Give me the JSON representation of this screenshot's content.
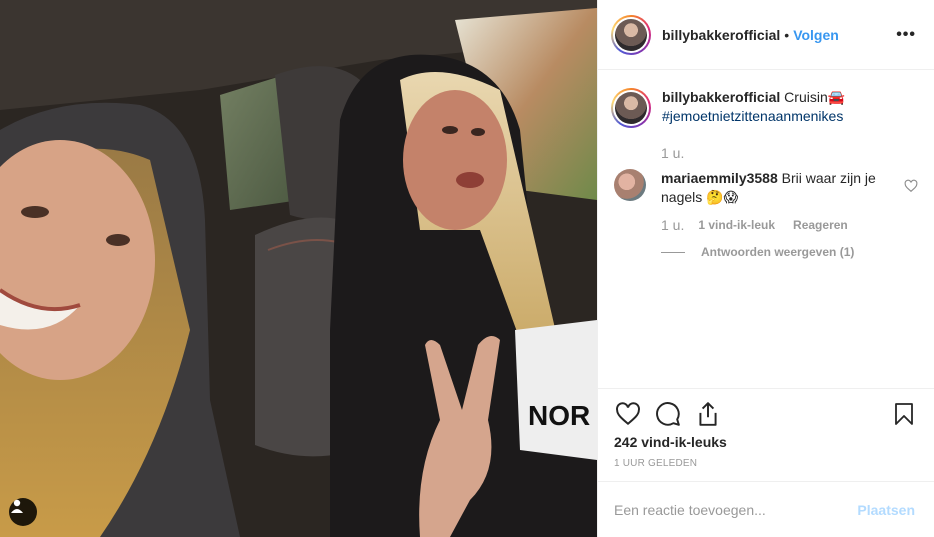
{
  "post": {
    "username": "billybakkerofficial",
    "follow_separator": "•",
    "follow_label": "Volgen",
    "more_icon": "more-options-icon",
    "more_label": "•••"
  },
  "caption": {
    "username": "billybakkerofficial",
    "text": "Cruisin🚘",
    "hashtag": "#jemoetnietzittenaanmenikes",
    "time": "1 u."
  },
  "comment": {
    "username": "mariaemmily3588",
    "text": "Brii waar zijn je nagels 🤔😱",
    "time": "1 u.",
    "likes_label": "1 vind-ik-leuk",
    "reply_label": "Reageren",
    "view_replies_label": "Antwoorden weergeven (1)"
  },
  "actions": {
    "like_icon": "heart-icon",
    "comment_icon": "comment-icon",
    "share_icon": "share-icon",
    "save_icon": "bookmark-icon"
  },
  "likes": "242 vind-ik-leuks",
  "timestamp": "1 UUR GELEDEN",
  "add_comment": {
    "placeholder": "Een reactie toevoegen...",
    "post_label": "Plaatsen"
  },
  "colors": {
    "link_blue": "#3897f0",
    "hashtag_blue": "#003569",
    "muted_grey": "#999999",
    "post_disabled": "#b3dbff"
  }
}
